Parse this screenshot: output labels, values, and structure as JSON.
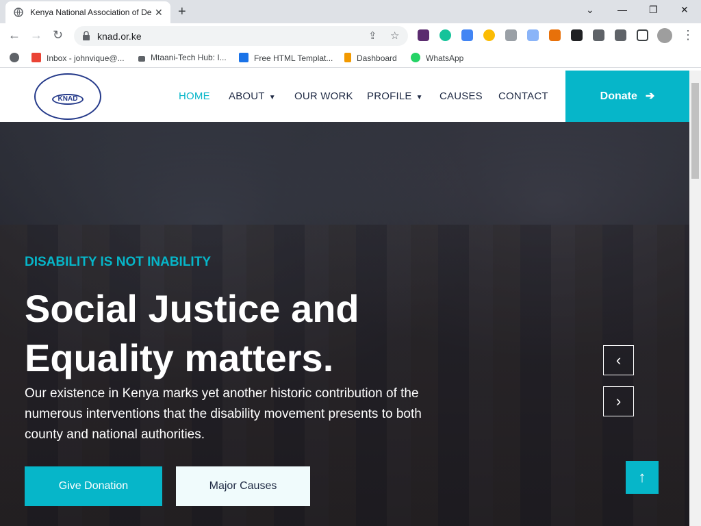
{
  "browser": {
    "tab_title": "Kenya National Association of De",
    "tab_close": "✕",
    "new_tab": "+",
    "window": {
      "minimize": "—",
      "restore": "❐",
      "close": "✕",
      "tabsearch": "⌄"
    },
    "url": "knad.or.ke",
    "bookmarks": [
      {
        "label": "Inbox - johnvique@...",
        "icon": "gmail-icon",
        "color": "#ea4335"
      },
      {
        "label": "Mtaani-Tech Hub: I...",
        "icon": "monitor-icon",
        "color": "#5f6368"
      },
      {
        "label": "Free HTML Templat...",
        "icon": "template-icon",
        "color": "#1a73e8"
      },
      {
        "label": "Dashboard",
        "icon": "p-icon",
        "color": "#f29900"
      },
      {
        "label": "WhatsApp",
        "icon": "whatsapp-icon",
        "color": "#25d366"
      }
    ]
  },
  "site": {
    "logo_text": "KNAD",
    "menu": [
      {
        "label": "HOME",
        "active": true
      },
      {
        "label": "ABOUT",
        "dropdown": true
      },
      {
        "label": "OUR WORK"
      },
      {
        "label": "PROFILE",
        "dropdown": true
      },
      {
        "label": "CAUSES"
      },
      {
        "label": "CONTACT"
      }
    ],
    "donate_label": "Donate",
    "hero": {
      "tagline": "DISABILITY IS NOT INABILITY",
      "headline_1": "Social Justice and",
      "headline_2": "Equality matters.",
      "paragraph": "Our existence in Kenya marks yet another historic contribution of the numerous interventions that the disability movement presents to both county and national authorities.",
      "btn_primary": "Give Donation",
      "btn_secondary": "Major Causes",
      "prev": "‹",
      "next": "›",
      "to_top": "↑"
    }
  },
  "colors": {
    "accent": "#06b6c9",
    "nav_text": "#1f2a44"
  }
}
